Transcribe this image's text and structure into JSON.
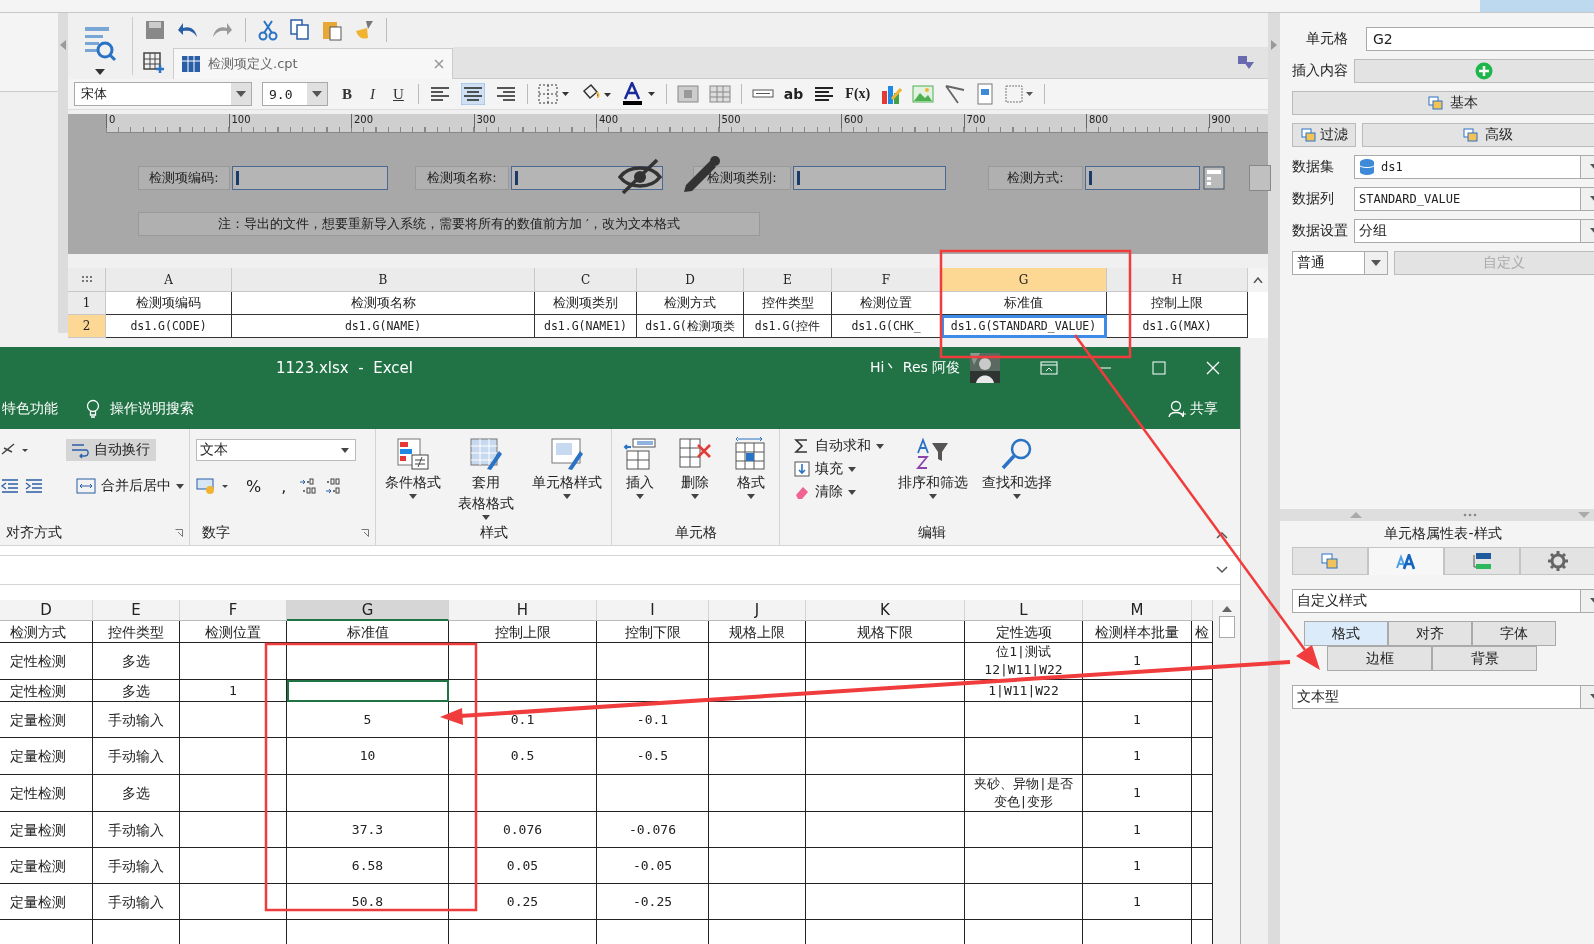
{
  "designer": {
    "file_tab": {
      "title": "检测项定义.cpt",
      "selected": true
    },
    "font": {
      "family": "宋体",
      "size": "9.0"
    },
    "format_buttons": [
      "B",
      "I",
      "U"
    ],
    "text_tools": [
      "ab",
      "F(x)"
    ],
    "ruler": [
      "0",
      "100",
      "200",
      "300",
      "400",
      "500",
      "600",
      "700",
      "800",
      "900"
    ],
    "form_fields": [
      {
        "label": "检测项编码:"
      },
      {
        "label": "检测项名称:"
      },
      {
        "label": "检测项类别:"
      },
      {
        "label": "检测方式:"
      }
    ],
    "note": "注：导出的文件，想要重新导入系统，需要将所有的数值前方加 ′，改为文本格式",
    "grid": {
      "columns": [
        {
          "letter": "A",
          "selected": false
        },
        {
          "letter": "B",
          "selected": false
        },
        {
          "letter": "C",
          "selected": false
        },
        {
          "letter": "D",
          "selected": false
        },
        {
          "letter": "E",
          "selected": false
        },
        {
          "letter": "F",
          "selected": false
        },
        {
          "letter": "G",
          "selected": true
        },
        {
          "letter": "H",
          "selected": false
        }
      ],
      "rows": [
        {
          "number": "1",
          "selected": false,
          "cells": [
            "检测项编码",
            "检测项名称",
            "检测项类别",
            "检测方式",
            "控件类型",
            "检测位置",
            "标准值",
            "控制上限"
          ]
        },
        {
          "number": "2",
          "selected": true,
          "cells": [
            "ds1.G(CODE)",
            "ds1.G(NAME)",
            "ds1.G(NAME1)",
            "ds1.G(检测项类",
            "ds1.G(控件",
            "ds1.G(CHK_",
            "ds1.G(STANDARD_VALUE)",
            "ds1.G(MAX)"
          ]
        }
      ]
    }
  },
  "cell_properties": {
    "cell": {
      "label": "单元格",
      "value": "G2"
    },
    "insert": {
      "label": "插入内容"
    },
    "basic_button": "基本",
    "filter_button": "过滤",
    "advanced_button": "高级",
    "dataset": {
      "label": "数据集",
      "value": "ds1"
    },
    "column": {
      "label": "数据列",
      "value": "STANDARD_VALUE"
    },
    "setting": {
      "label": "数据设置",
      "value": "分组"
    },
    "mode": {
      "value": "普通"
    },
    "custom_button": {
      "label": "自定义",
      "disabled": true
    }
  },
  "style_panel": {
    "title": "单元格属性表-样式",
    "tabs": [
      {
        "kind": "copy",
        "selected": false
      },
      {
        "kind": "font",
        "selected": true
      },
      {
        "kind": "layout",
        "selected": false
      },
      {
        "kind": "gear",
        "selected": false
      }
    ],
    "style_select": "自定义样式",
    "sub_tabs": [
      {
        "label": "格式",
        "selected": true
      },
      {
        "label": "对齐",
        "selected": false
      },
      {
        "label": "字体",
        "selected": false
      },
      {
        "label": "边框",
        "selected": false
      },
      {
        "label": "背景",
        "selected": false
      }
    ],
    "format_select": "文本型"
  },
  "excel": {
    "title": "1123.xlsx  -  Excel",
    "user": "Hi丶 Res 阿俊",
    "menu": "特色功能",
    "search": "操作说明搜索",
    "share": "共享",
    "ribbon": {
      "alignment": {
        "label": "对齐方式",
        "wrap": {
          "label": "自动换行",
          "on": true
        },
        "merge": "合并后居中"
      },
      "number": {
        "label": "数字",
        "format": "文本",
        "percent": "%",
        "comma": ","
      },
      "styles": {
        "label": "样式",
        "buttons": [
          [
            "条件格式"
          ],
          [
            "套用",
            "表格格式"
          ],
          [
            "单元格样式"
          ]
        ]
      },
      "cells": {
        "label": "单元格",
        "buttons": [
          "插入",
          "删除",
          "格式"
        ]
      },
      "editing": {
        "label": "编辑",
        "small": [
          "自动求和",
          "填充",
          "清除"
        ],
        "buttons": [
          "排序和筛选",
          "查找和选择"
        ]
      }
    },
    "sheet": {
      "columns": [
        {
          "letter": "D",
          "selected": false
        },
        {
          "letter": "E",
          "selected": false
        },
        {
          "letter": "F",
          "selected": false
        },
        {
          "letter": "G",
          "selected": true
        },
        {
          "letter": "H",
          "selected": false
        },
        {
          "letter": "I",
          "selected": false
        },
        {
          "letter": "J",
          "selected": false
        },
        {
          "letter": "K",
          "selected": false
        },
        {
          "letter": "L",
          "selected": false
        },
        {
          "letter": "M",
          "selected": false
        },
        {
          "selected": false
        }
      ],
      "header": [
        "检测方式",
        "控件类型",
        "检测位置",
        "标准值",
        "控制上限",
        "控制下限",
        "规格上限",
        "规格下限",
        "定性选项",
        "检测样本批量",
        "检"
      ],
      "rows": [
        {
          "selected": false,
          "cells": [
            "定性检测",
            "多选",
            null,
            null,
            null,
            null,
            null,
            null,
            [
              "位1|测试",
              "12|W11|W22"
            ],
            "1",
            null
          ]
        },
        {
          "selected": true,
          "cells": [
            "定性检测",
            "多选",
            "1",
            null,
            null,
            null,
            null,
            null,
            "1|W11|W22",
            null,
            null
          ]
        },
        {
          "selected": false,
          "cells": [
            "定量检测",
            "手动输入",
            null,
            "5",
            "0.1",
            "-0.1",
            null,
            null,
            null,
            "1",
            null
          ]
        },
        {
          "selected": false,
          "cells": [
            "定量检测",
            "手动输入",
            null,
            "10",
            "0.5",
            "-0.5",
            null,
            null,
            null,
            "1",
            null
          ]
        },
        {
          "selected": false,
          "cells": [
            "定性检测",
            "多选",
            null,
            null,
            null,
            null,
            null,
            null,
            [
              "夹砂、异物|是否",
              "变色|变形"
            ],
            "1",
            null
          ]
        },
        {
          "selected": false,
          "cells": [
            "定量检测",
            "手动输入",
            null,
            "37.3",
            "0.076",
            "-0.076",
            null,
            null,
            null,
            "1",
            null
          ]
        },
        {
          "selected": false,
          "cells": [
            "定量检测",
            "手动输入",
            null,
            "6.58",
            "0.05",
            "-0.05",
            null,
            null,
            null,
            "1",
            null
          ]
        },
        {
          "selected": false,
          "cells": [
            "定量检测",
            "手动输入",
            null,
            "50.8",
            "0.25",
            "-0.25",
            null,
            null,
            null,
            "1",
            null
          ]
        }
      ]
    }
  }
}
